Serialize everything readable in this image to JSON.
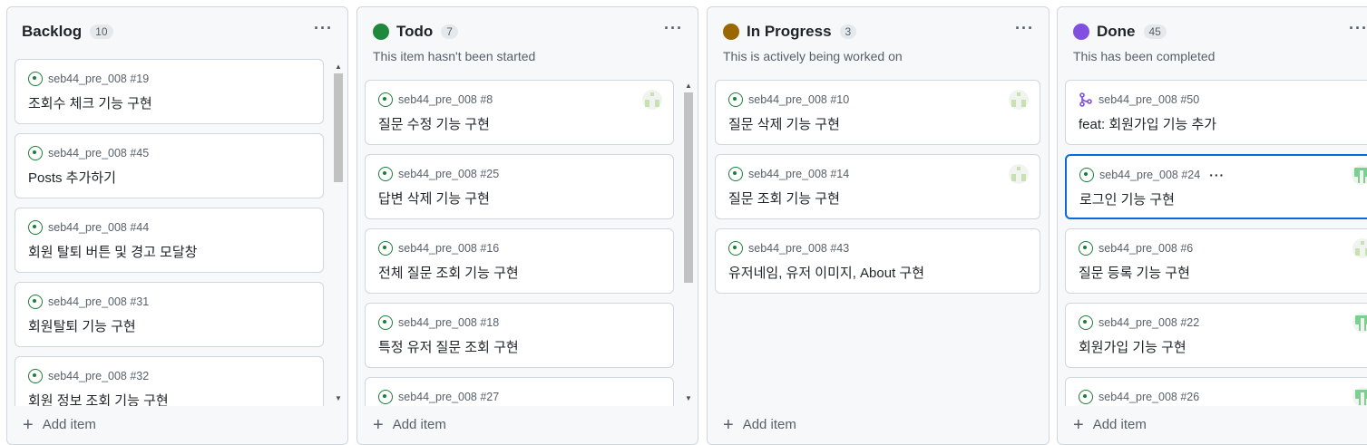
{
  "columns": [
    {
      "id": "backlog",
      "title": "Backlog",
      "count": "10",
      "description": "",
      "dot_color": "",
      "add_item": "Add item",
      "cards": [
        {
          "ref": "seb44_pre_008 #19",
          "title": "조회수 체크 기능 구현",
          "icon": "issue-open-icon"
        },
        {
          "ref": "seb44_pre_008 #45",
          "title": "Posts 추가하기",
          "icon": "issue-open-icon"
        },
        {
          "ref": "seb44_pre_008 #44",
          "title": "회원 탈퇴 버튼 및 경고 모달창",
          "icon": "issue-open-icon"
        },
        {
          "ref": "seb44_pre_008 #31",
          "title": "회원탈퇴 기능 구현",
          "icon": "issue-open-icon"
        },
        {
          "ref": "seb44_pre_008 #32",
          "title": "회원 정보 조회 기능 구현",
          "icon": "issue-open-icon"
        }
      ]
    },
    {
      "id": "todo",
      "title": "Todo",
      "count": "7",
      "description": "This item hasn't been started",
      "dot_color": "#1f883d",
      "add_item": "Add item",
      "cards": [
        {
          "ref": "seb44_pre_008 #8",
          "title": "질문 수정 기능 구현",
          "icon": "issue-open-icon",
          "avatar": "light"
        },
        {
          "ref": "seb44_pre_008 #25",
          "title": "답변 삭제 기능 구현",
          "icon": "issue-open-icon"
        },
        {
          "ref": "seb44_pre_008 #16",
          "title": "전체 질문 조회 기능 구현",
          "icon": "issue-open-icon"
        },
        {
          "ref": "seb44_pre_008 #18",
          "title": "특정 유저 질문 조회 구현",
          "icon": "issue-open-icon"
        },
        {
          "ref": "seb44_pre_008 #27",
          "title": "",
          "icon": "issue-open-icon"
        }
      ]
    },
    {
      "id": "inprogress",
      "title": "In Progress",
      "count": "3",
      "description": "This is actively being worked on",
      "dot_color": "#9a6700",
      "add_item": "Add item",
      "cards": [
        {
          "ref": "seb44_pre_008 #10",
          "title": "질문 삭제 기능 구현",
          "icon": "issue-open-icon",
          "avatar": "light"
        },
        {
          "ref": "seb44_pre_008 #14",
          "title": "질문 조회 기능 구현",
          "icon": "issue-open-icon",
          "avatar": "light"
        },
        {
          "ref": "seb44_pre_008 #43",
          "title": "유저네임, 유저 이미지, About 구현",
          "icon": "issue-open-icon"
        }
      ]
    },
    {
      "id": "done",
      "title": "Done",
      "count": "45",
      "description": "This has been completed",
      "dot_color": "#8250df",
      "add_item": "Add item",
      "cards": [
        {
          "ref": "seb44_pre_008 #50",
          "title": "feat: 회원가입 기능 추가",
          "icon": "pull-request-merged-icon"
        },
        {
          "ref": "seb44_pre_008 #24",
          "title": "로그인 기능 구현",
          "icon": "issue-open-icon",
          "avatar": "green",
          "selected": true
        },
        {
          "ref": "seb44_pre_008 #6",
          "title": "질문 등록 기능 구현",
          "icon": "issue-open-icon",
          "avatar": "light"
        },
        {
          "ref": "seb44_pre_008 #22",
          "title": "회원가입 기능 구현",
          "icon": "issue-open-icon",
          "avatar": "green"
        },
        {
          "ref": "seb44_pre_008 #26",
          "title": "",
          "icon": "issue-open-icon",
          "avatar": "green"
        }
      ]
    }
  ],
  "colors": {
    "issue_open": "#1a7f37",
    "pr_merged": "#8250df",
    "selected_border": "#0969da"
  }
}
